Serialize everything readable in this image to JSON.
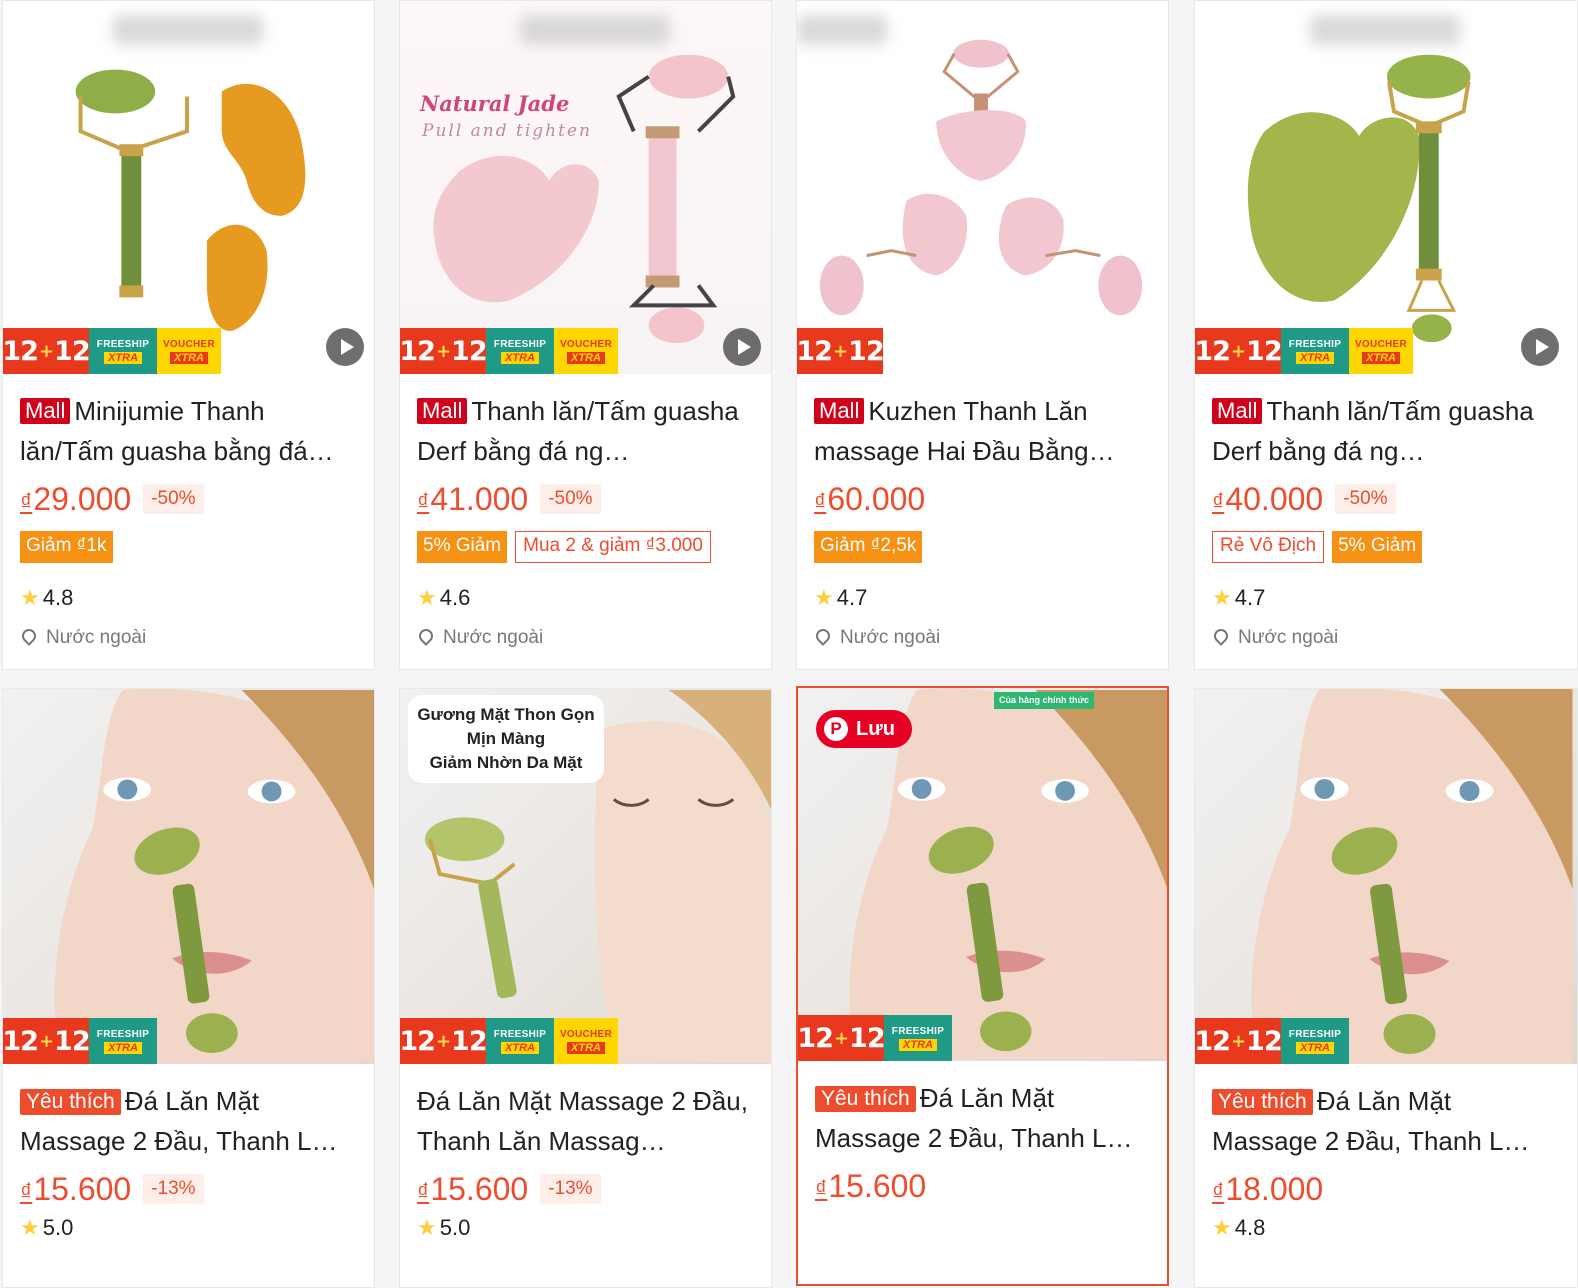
{
  "promo": {
    "tag_1212": "12.12",
    "freeship_top": "FREESHIP",
    "freeship_bot": "XTRA",
    "voucher_top": "VOUCHER",
    "voucher_bot": "XTRA"
  },
  "colors": {
    "accent": "#ee4d2d",
    "mall": "#d0011b",
    "star": "#ffce3d",
    "tag": "#f69113"
  },
  "row1": [
    {
      "badge": "Mall",
      "title": "Minijumie Thanh lăn/Tấm guasha bằng đá…",
      "currency": "₫",
      "price": "29.000",
      "discount": "-50%",
      "tags_fill": [
        "Giảm ₫1k"
      ],
      "tags_outline": [],
      "rating": "4.8",
      "location": "Nước ngoài"
    },
    {
      "badge": "Mall",
      "title": "Thanh lăn/Tấm guasha Derf bằng đá ng…",
      "currency": "₫",
      "price": "41.000",
      "discount": "-50%",
      "tags_fill": [
        "5% Giảm"
      ],
      "tags_outline": [
        "Mua 2 & giảm ₫3.000"
      ],
      "rating": "4.6",
      "location": "Nước ngoài",
      "image_text_1": "Natural Jade",
      "image_text_2": "Pull and tighten"
    },
    {
      "badge": "Mall",
      "title": "Kuzhen Thanh Lăn massage Hai Đầu Bằng…",
      "currency": "₫",
      "price": "60.000",
      "discount": "",
      "tags_fill": [
        "Giảm ₫2,5k"
      ],
      "tags_outline": [],
      "rating": "4.7",
      "location": "Nước ngoài"
    },
    {
      "badge": "Mall",
      "title": "Thanh lăn/Tấm guasha Derf bằng đá ng…",
      "currency": "₫",
      "price": "40.000",
      "discount": "-50%",
      "tags_fill": [
        "5% Giảm"
      ],
      "tags_outline": [
        "Rẻ Vô Địch"
      ],
      "rating": "4.7",
      "location": "Nước ngoài"
    }
  ],
  "row2": [
    {
      "badge": "Yêu thích",
      "title": "Đá Lăn Mặt Massage 2 Đầu, Thanh L…",
      "currency": "₫",
      "price": "15.600",
      "discount": "-13%",
      "rating": "5.0"
    },
    {
      "badge": "",
      "title": "Đá Lăn Mặt Massage 2 Đầu, Thanh Lăn Massag…",
      "currency": "₫",
      "price": "15.600",
      "discount": "-13%",
      "rating": "5.0",
      "image_text": [
        "Gương Mặt Thon Gọn",
        "Mịn Màng",
        "Giảm Nhờn Da Mặt"
      ]
    },
    {
      "badge": "Yêu thích",
      "title": "Đá Lăn Mặt Massage 2 Đầu, Thanh L…",
      "currency": "₫",
      "price": "15.600",
      "discount": "",
      "rating": "",
      "save_label": "Lưu",
      "official_label": "Của hàng chính thức"
    },
    {
      "badge": "Yêu thích",
      "title": "Đá Lăn Mặt Massage 2 Đầu, Thanh L…",
      "currency": "₫",
      "price": "18.000",
      "discount": "",
      "rating": "4.8"
    }
  ]
}
